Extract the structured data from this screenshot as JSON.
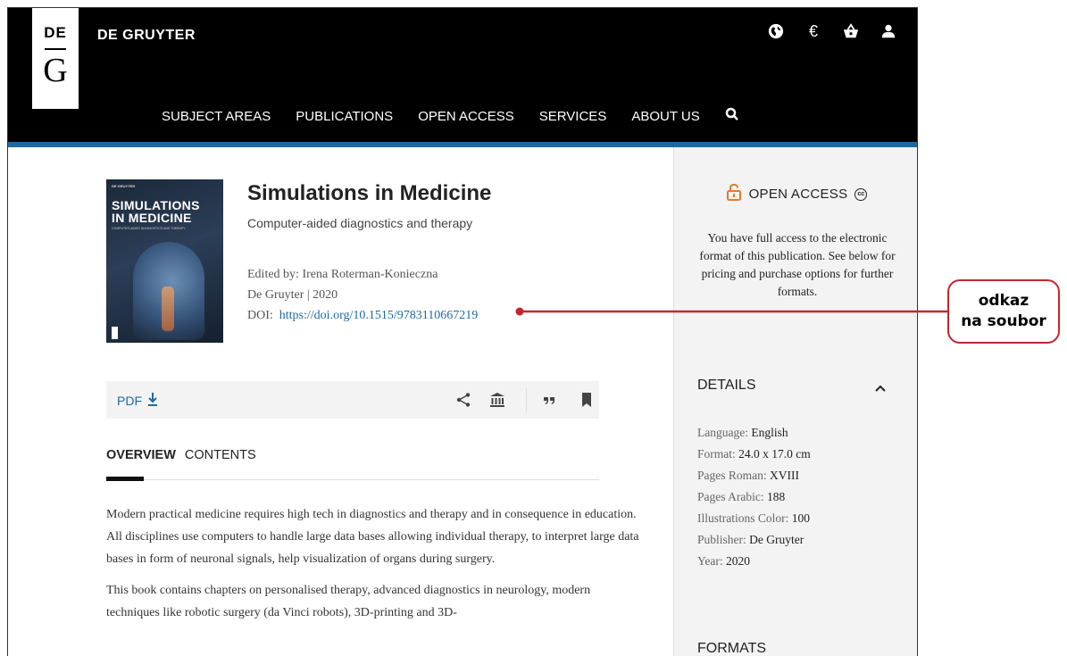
{
  "header": {
    "logo": {
      "top": "DE",
      "bottom": "G"
    },
    "brand": "DE GRUYTER",
    "icons": [
      "globe-icon",
      "euro-icon",
      "basket-icon",
      "user-icon"
    ],
    "currency_symbol": "€",
    "nav": [
      "SUBJECT AREAS",
      "PUBLICATIONS",
      "OPEN ACCESS",
      "SERVICES",
      "ABOUT US"
    ],
    "accent_color": "#1d6aa0"
  },
  "book": {
    "cover": {
      "publisher": "DE GRUYTER",
      "title_line1": "SIMULATIONS",
      "title_line2": "IN MEDICINE",
      "subtitle": "COMPUTER-AIDED DIAGNOSTICS AND THERAPY"
    },
    "title": "Simulations in Medicine",
    "subtitle": "Computer-aided diagnostics and therapy",
    "edited_by_label": "Edited by:",
    "edited_by": "Irena Roterman-Konieczna",
    "publisher_line": "De Gruyter | 2020",
    "doi_label": "DOI:",
    "doi": "https://doi.org/10.1515/9783110667219"
  },
  "toolbar": {
    "pdf_label": "PDF",
    "icons": [
      "share-icon",
      "institution-icon",
      "quote-icon",
      "bookmark-icon"
    ]
  },
  "tabs": [
    "OVERVIEW",
    "CONTENTS"
  ],
  "overview": {
    "p1": "Modern practical medicine requires high tech in diagnostics and therapy and in consequence in education. All disciplines use computers to handle large data bases allowing individual therapy, to interpret large data bases in form of neuronal signals, help visualization of organs during surgery.",
    "p2": "This book contains chapters on personalised therapy, advanced diagnostics in neurology, modern techniques like robotic surgery (da Vinci robots), 3D-printing and 3D-"
  },
  "sidebar": {
    "open_access_label": "OPEN ACCESS",
    "open_access_text": "You have full access to the electronic format of this publication. See below for pricing and purchase options for further formats.",
    "details_title": "DETAILS",
    "details": [
      {
        "label": "Language:",
        "value": "English"
      },
      {
        "label": "Format:",
        "value": "24.0 x 17.0 cm"
      },
      {
        "label": "Pages Roman:",
        "value": "XVIII"
      },
      {
        "label": "Pages Arabic:",
        "value": "188"
      },
      {
        "label": "Illustrations Color:",
        "value": "100"
      },
      {
        "label": "Publisher:",
        "value": "De Gruyter"
      },
      {
        "label": "Year:",
        "value": "2020"
      }
    ],
    "formats_title": "FORMATS",
    "lock_color": "#e8792b"
  },
  "callout": {
    "line1": "odkaz",
    "line2": "na soubor",
    "color": "#c0282e"
  }
}
